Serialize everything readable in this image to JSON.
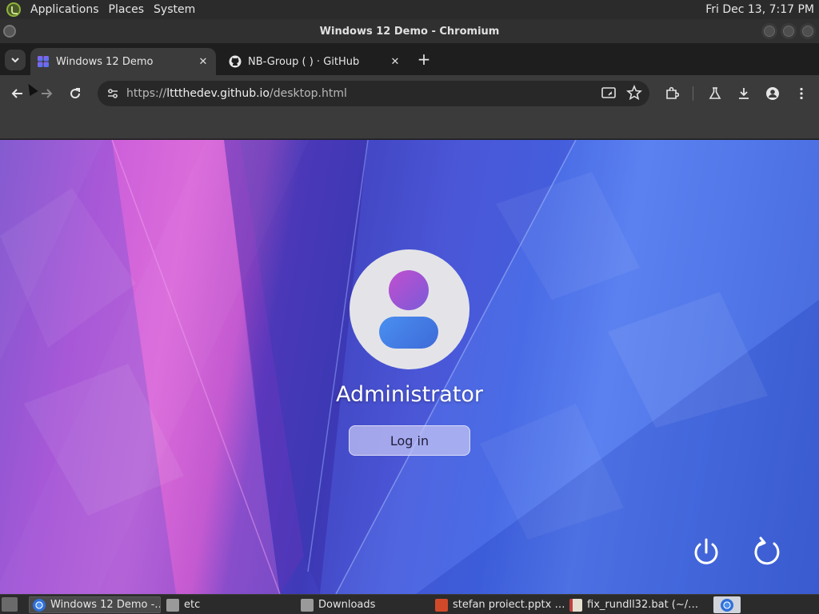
{
  "system_panel": {
    "menus": [
      "Applications",
      "Places",
      "System"
    ],
    "clock": "Fri Dec 13,  7:17 PM"
  },
  "window": {
    "title": "Windows 12 Demo - Chromium"
  },
  "tabs": [
    {
      "label": "Windows 12 Demo",
      "close": "✕",
      "active": true
    },
    {
      "label": "NB-Group (      ) · GitHub",
      "close": "✕",
      "active": false
    }
  ],
  "new_tab": "+",
  "toolbar": {
    "url_scheme": "https://",
    "url_host": "lttthedev.github.io",
    "url_path": "/desktop.html"
  },
  "login": {
    "username": "Administrator",
    "login_label": "Log in"
  },
  "taskbar": {
    "items": [
      {
        "label": "Windows 12 Demo -…",
        "active": true
      },
      {
        "label": "etc",
        "active": false
      },
      {
        "label": "Downloads",
        "active": false
      },
      {
        "label": "stefan proiect.pptx …",
        "active": false
      },
      {
        "label": "fix_rundll32.bat (~/…",
        "active": false
      }
    ]
  },
  "colors": {
    "wallpaper_pink": "#d86ad8",
    "wallpaper_blue": "#4a70e4",
    "avatar_bg": "#e4e4e8",
    "button_bg": "#c8c8f5"
  },
  "icons": {
    "tab1": "windows-logo-icon",
    "tab2": "github-icon",
    "back": "arrow-left-icon",
    "forward": "arrow-right-icon",
    "reload": "reload-icon",
    "site_info": "tune-icon",
    "cast": "cast-icon",
    "bookmark": "star-icon",
    "extensions": "puzzle-icon",
    "labs": "flask-icon",
    "download": "download-icon",
    "profile": "person-icon",
    "menu": "kebab-menu-icon",
    "power": "power-icon",
    "restart": "restart-icon"
  }
}
